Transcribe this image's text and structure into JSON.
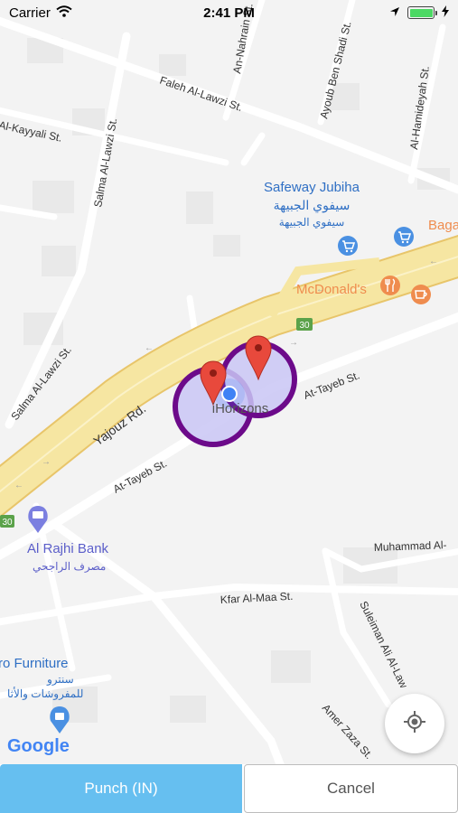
{
  "status_bar": {
    "carrier": "Carrier",
    "time": "2:41 PM",
    "battery_level": 1.0,
    "icons": [
      "wifi-icon",
      "location-arrow-icon",
      "battery-icon",
      "charging-bolt-icon"
    ]
  },
  "map": {
    "streets": {
      "faleh": "Faleh Al-Lawzi St.",
      "an_nahrain": "An-Nahrain St.",
      "ayoub": "Ayoub Ben Shadi St.",
      "hamideyah": "Al-Hamideyah St.",
      "kayyali": "Al-Kayyali St.",
      "salma_top": "Salma Al-Lawzi St.",
      "salma_bottom": "Salma Al-Lawzi St.",
      "yajouz": "Yajouz Rd.",
      "at_tayeb_right": "At-Tayeb St.",
      "at_tayeb_left": "At-Tayeb St.",
      "muhammad": "Muhammad Al-",
      "kfar": "Kfar Al-Maa St.",
      "suleiman": "Suleiman Ali Al-Law",
      "amer": "Amer Zaza St."
    },
    "pois": {
      "safeway_en": "Safeway Jubiha",
      "safeway_ar1": "سيفوي الجبيهة",
      "safeway_ar2": "سيفوي الجبيهة",
      "baga": "Baga",
      "mcdonalds": "McDonald's",
      "alrajhi_en": "Al Rajhi Bank",
      "alrajhi_ar": "مصرف الراجحي",
      "furniture_en": "ro Furniture",
      "furniture_ar1": "سنترو",
      "furniture_ar2": "للمفروشات والأثا"
    },
    "route_shields": {
      "shield_1": "30",
      "shield_2": "30"
    },
    "center_label": "iHorizons",
    "google_logo": "Google",
    "colors": {
      "map_background": "#f3f3f3",
      "road_main": "#f6e6a2",
      "road_main_border": "#e8c56a",
      "road_minor": "#ffffff",
      "geofence_fill": "#c9c5f5",
      "geofence_stroke": "#6c0a8a",
      "marker_red": "#e8493c",
      "user_dot": "#3f82f5",
      "poi_blue": "#4a90e2",
      "poi_orange": "#ef8c4e",
      "shield_green": "#5ba24a"
    }
  },
  "locate_button": {
    "icon": "crosshair-icon"
  },
  "actions": {
    "punch_label": "Punch (IN)",
    "cancel_label": "Cancel",
    "punch_color": "#66bff0"
  }
}
